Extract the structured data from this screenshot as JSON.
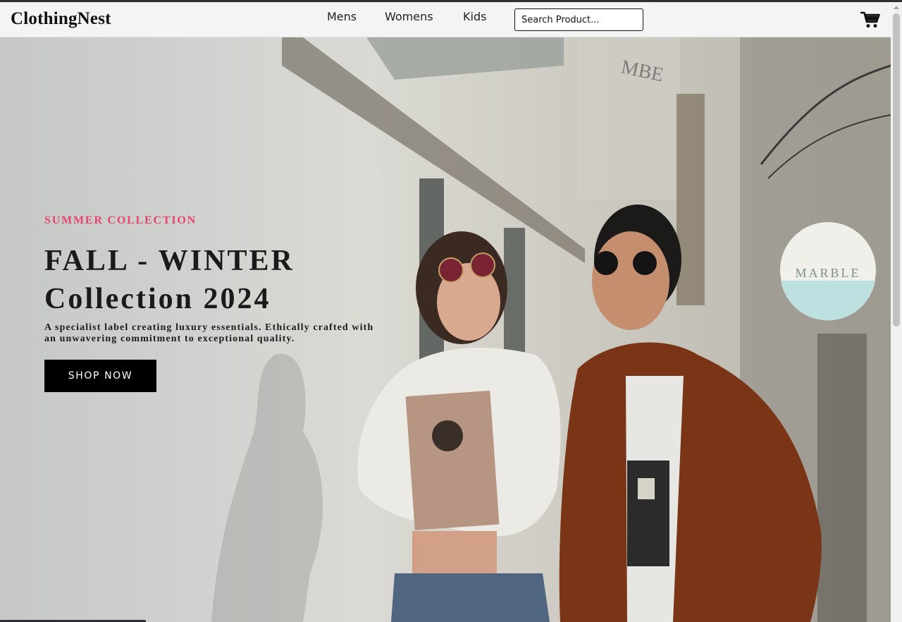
{
  "brand": {
    "name": "ClothingNest"
  },
  "nav": {
    "links": [
      {
        "label": "Mens"
      },
      {
        "label": "Womens"
      },
      {
        "label": "Kids"
      }
    ],
    "search_placeholder": "Search Product...",
    "cart_icon": "shopping-cart-icon"
  },
  "hero": {
    "eyebrow": "SUMMER COLLECTION",
    "headline_line1": "FALL - WINTER",
    "headline_line2": "Collection 2024",
    "description": "A specialist label creating luxury essentials. Ethically crafted with an unwavering commitment to exceptional quality.",
    "cta_label": "SHOP NOW",
    "sign_text": "MARBLE"
  },
  "colors": {
    "accent": "#e8456e",
    "nav_background": "#f4f4f4",
    "button_background": "#000000",
    "text_dark": "#1a1a1a"
  }
}
